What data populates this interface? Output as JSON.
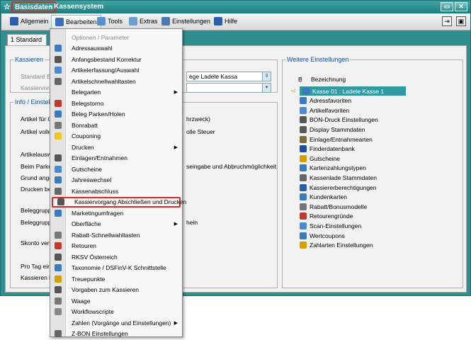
{
  "window": {
    "title_highlight": "Basisdaten",
    "title_rest": " - Kassensystem",
    "controls": [
      "▭",
      "✕"
    ]
  },
  "toolbar": {
    "items": [
      {
        "label": "Allgemein",
        "icon": "arrow-icon",
        "color": "#2a5db0"
      },
      {
        "label": "Bearbeiten",
        "icon": "edit-icon",
        "color": "#3a6fbf"
      },
      {
        "label": "Tools",
        "icon": "tools-icon",
        "color": "#5a8fcf"
      },
      {
        "label": "Extras",
        "icon": "extras-icon",
        "color": "#6aa0d0"
      },
      {
        "label": "Einstellungen",
        "icon": "settings-icon",
        "color": "#4a7ab0"
      },
      {
        "label": "Hilfe",
        "icon": "help-icon",
        "color": "#2a5db0"
      }
    ]
  },
  "tabs": [
    {
      "label": "1 Standard"
    }
  ],
  "kassieren": {
    "legend": "Kassieren",
    "rows": [
      {
        "label": "Standard Bar"
      },
      {
        "label": "Kassiervorga"
      }
    ],
    "input_value": "ege Ladele Kassa"
  },
  "info": {
    "legend": "Info / Einstellu",
    "rows": [
      {
        "label": "Artikel für Gu",
        "right": "hrzweck)"
      },
      {
        "label": "Artikel voller",
        "right": "olle Steuer"
      },
      {
        "label": "Artikelauswahl",
        "right": ""
      },
      {
        "label": "Beim Parken I",
        "right": "seingabe und Abbruchmöglichkeit"
      },
      {
        "label": "Grund angeb",
        "right": ""
      },
      {
        "label": "Drucken bei E",
        "right": ""
      },
      {
        "label": "Beleggruppe",
        "right": ""
      },
      {
        "label": "Beleggruppe",
        "right": "hein"
      },
      {
        "label": "Skonto verwe",
        "right": ""
      },
      {
        "label": "Pro Tag einer",
        "right": ""
      },
      {
        "label": "Kassieren bis",
        "right": ""
      }
    ]
  },
  "weitere": {
    "legend": "Weitere Einstellungen",
    "header_b": "B",
    "header_bez": "Bezeichnung",
    "items": [
      {
        "label": "Kasse 01 : Ladele Kasse 1",
        "color": "#3a7abf"
      },
      {
        "label": "Adressfavoriten",
        "color": "#3b7ac4"
      },
      {
        "label": "Artikelfavoriten",
        "color": "#4a8ad0"
      },
      {
        "label": "BON-Druck Einstellungen",
        "color": "#555"
      },
      {
        "label": "Display Stammdaten",
        "color": "#5a5a5a"
      },
      {
        "label": "Einlage/Entnahmearten",
        "color": "#7a6a3a"
      },
      {
        "label": "Finderdatenbank",
        "color": "#1a4fa0"
      },
      {
        "label": "Gutscheine",
        "color": "#d4a000"
      },
      {
        "label": "Kartenzahlungstypen",
        "color": "#3a7abf"
      },
      {
        "label": "Kassenlade Stammdaten",
        "color": "#666"
      },
      {
        "label": "Kassiererberechtigungen",
        "color": "#2a5db0"
      },
      {
        "label": "Kundenkarten",
        "color": "#3a7abf"
      },
      {
        "label": "Rabatt/Bonusmodelle",
        "color": "#777"
      },
      {
        "label": "Retourengründe",
        "color": "#c0392b"
      },
      {
        "label": "Scan-Einstellungen",
        "color": "#4a8ad0"
      },
      {
        "label": "Wertcoupons",
        "color": "#3a7abf"
      },
      {
        "label": "Zahlarten Einstellungen",
        "color": "#d4a000"
      }
    ]
  },
  "menu": {
    "items": [
      {
        "label": "Optionen / Parameter",
        "gray": true,
        "sub": false,
        "color": ""
      },
      {
        "label": "Adressauswahl",
        "gray": false,
        "sub": false,
        "color": "#3b7ac4"
      },
      {
        "label": "Anfangsbestand Korrektur",
        "gray": false,
        "sub": false,
        "color": "#555"
      },
      {
        "label": "Artikelerfassung/Auswahl",
        "gray": false,
        "sub": false,
        "color": "#4a8ad0"
      },
      {
        "label": "Artikelschnellwahltasten",
        "gray": false,
        "sub": false,
        "color": "#666"
      },
      {
        "label": "Belegarten",
        "gray": false,
        "sub": true,
        "color": ""
      },
      {
        "label": "Belegstorno",
        "gray": false,
        "sub": false,
        "color": "#c0392b"
      },
      {
        "label": "Beleg Parken/Holen",
        "gray": false,
        "sub": false,
        "color": "#3a7abf"
      },
      {
        "label": "Bonrabatt",
        "gray": false,
        "sub": false,
        "color": "#777"
      },
      {
        "label": "Couponing",
        "gray": false,
        "sub": false,
        "color": "#f0c419"
      },
      {
        "label": "Drucken",
        "gray": false,
        "sub": true,
        "color": ""
      },
      {
        "label": "Einlagen/Entnahmen",
        "gray": false,
        "sub": false,
        "color": "#555"
      },
      {
        "label": "Gutscheine",
        "gray": false,
        "sub": false,
        "color": "#4a8ad0"
      },
      {
        "label": "Jahreswechsel",
        "gray": false,
        "sub": false,
        "color": "#3a7abf"
      },
      {
        "label": "Kassenabschluss",
        "gray": false,
        "sub": false,
        "color": "#666"
      },
      {
        "label": "Kassiervorgang Abschließen und Drucken",
        "gray": false,
        "sub": false,
        "color": "#555",
        "highlight": true
      },
      {
        "label": "Marketingumfragen",
        "gray": false,
        "sub": false,
        "color": "#3a7abf"
      },
      {
        "label": "Oberfläche",
        "gray": false,
        "sub": true,
        "color": ""
      },
      {
        "label": "Rabatt-Schnellwahltasten",
        "gray": false,
        "sub": false,
        "color": "#777"
      },
      {
        "label": "Retouren",
        "gray": false,
        "sub": false,
        "color": "#c0392b"
      },
      {
        "label": "RKSV Österreich",
        "gray": false,
        "sub": false,
        "color": "#555"
      },
      {
        "label": "Taxonomie / DSFinV-K Schnittstelle",
        "gray": false,
        "sub": false,
        "color": "#3a7abf"
      },
      {
        "label": "Treuepunkte",
        "gray": false,
        "sub": false,
        "color": "#d4a000"
      },
      {
        "label": "Vorgaben zum Kassieren",
        "gray": false,
        "sub": false,
        "color": "#555"
      },
      {
        "label": "Waage",
        "gray": false,
        "sub": false,
        "color": "#777"
      },
      {
        "label": "Workflowscripte",
        "gray": false,
        "sub": false,
        "color": "#888"
      },
      {
        "label": "Zahlen (Vorgänge und Einstellungen)",
        "gray": false,
        "sub": true,
        "color": ""
      },
      {
        "label": "Z-BON Einstellungen",
        "gray": false,
        "sub": false,
        "color": "#666"
      }
    ]
  }
}
